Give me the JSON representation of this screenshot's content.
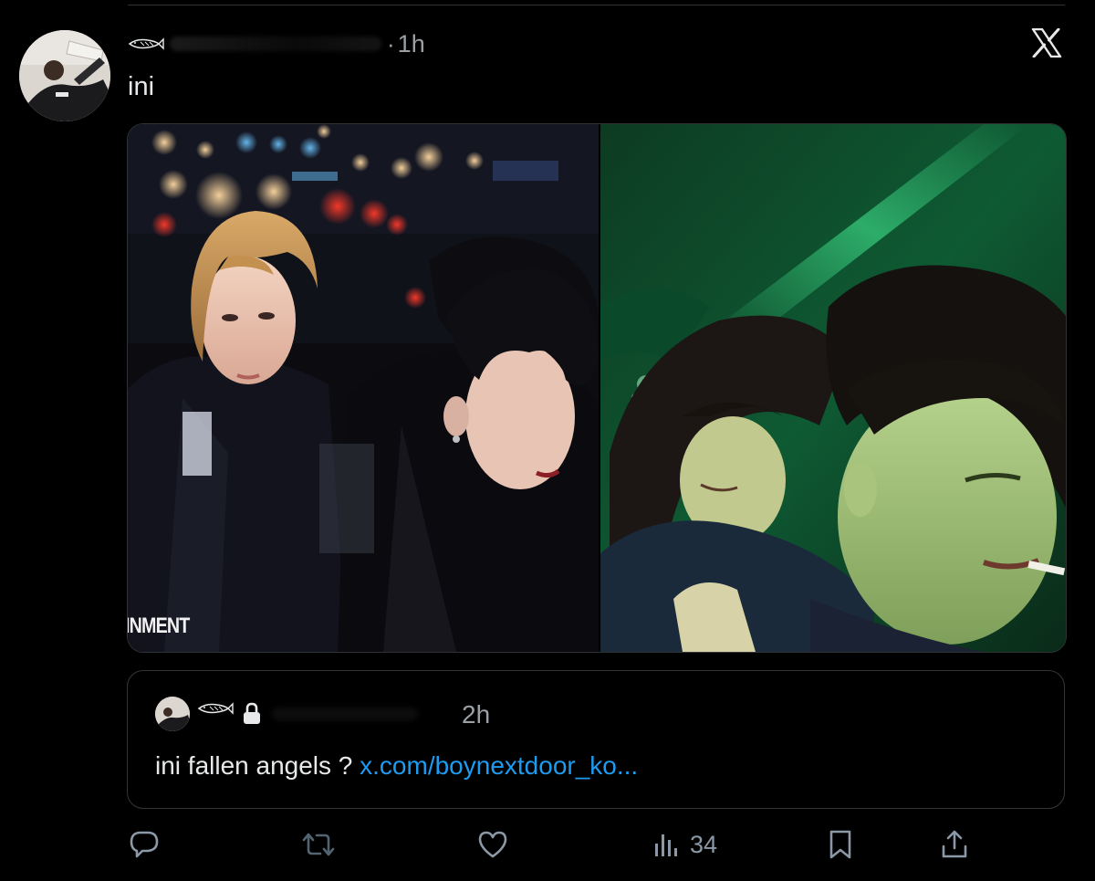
{
  "tweet": {
    "time_separator": "·",
    "time": "1h",
    "text": "ini"
  },
  "media": {
    "left_overlay_text": "INMENT",
    "right_image": "green-toned film still"
  },
  "quote": {
    "time": "2h",
    "text": "ini fallen angels ?",
    "link_text": "x.com/boynextdoor_ko..."
  },
  "actions": {
    "reply_icon": "reply-icon",
    "retweet_icon": "retweet-icon",
    "like_icon": "heart-icon",
    "views_icon": "views-icon",
    "views_count": "34",
    "bookmark_icon": "bookmark-icon",
    "share_icon": "share-icon"
  },
  "colors": {
    "background": "#000000",
    "text_primary": "#e7e9ea",
    "text_secondary": "#9aa0a6",
    "link": "#1d9bf0",
    "border": "#2f3336",
    "retweet_muted": "#536471"
  }
}
